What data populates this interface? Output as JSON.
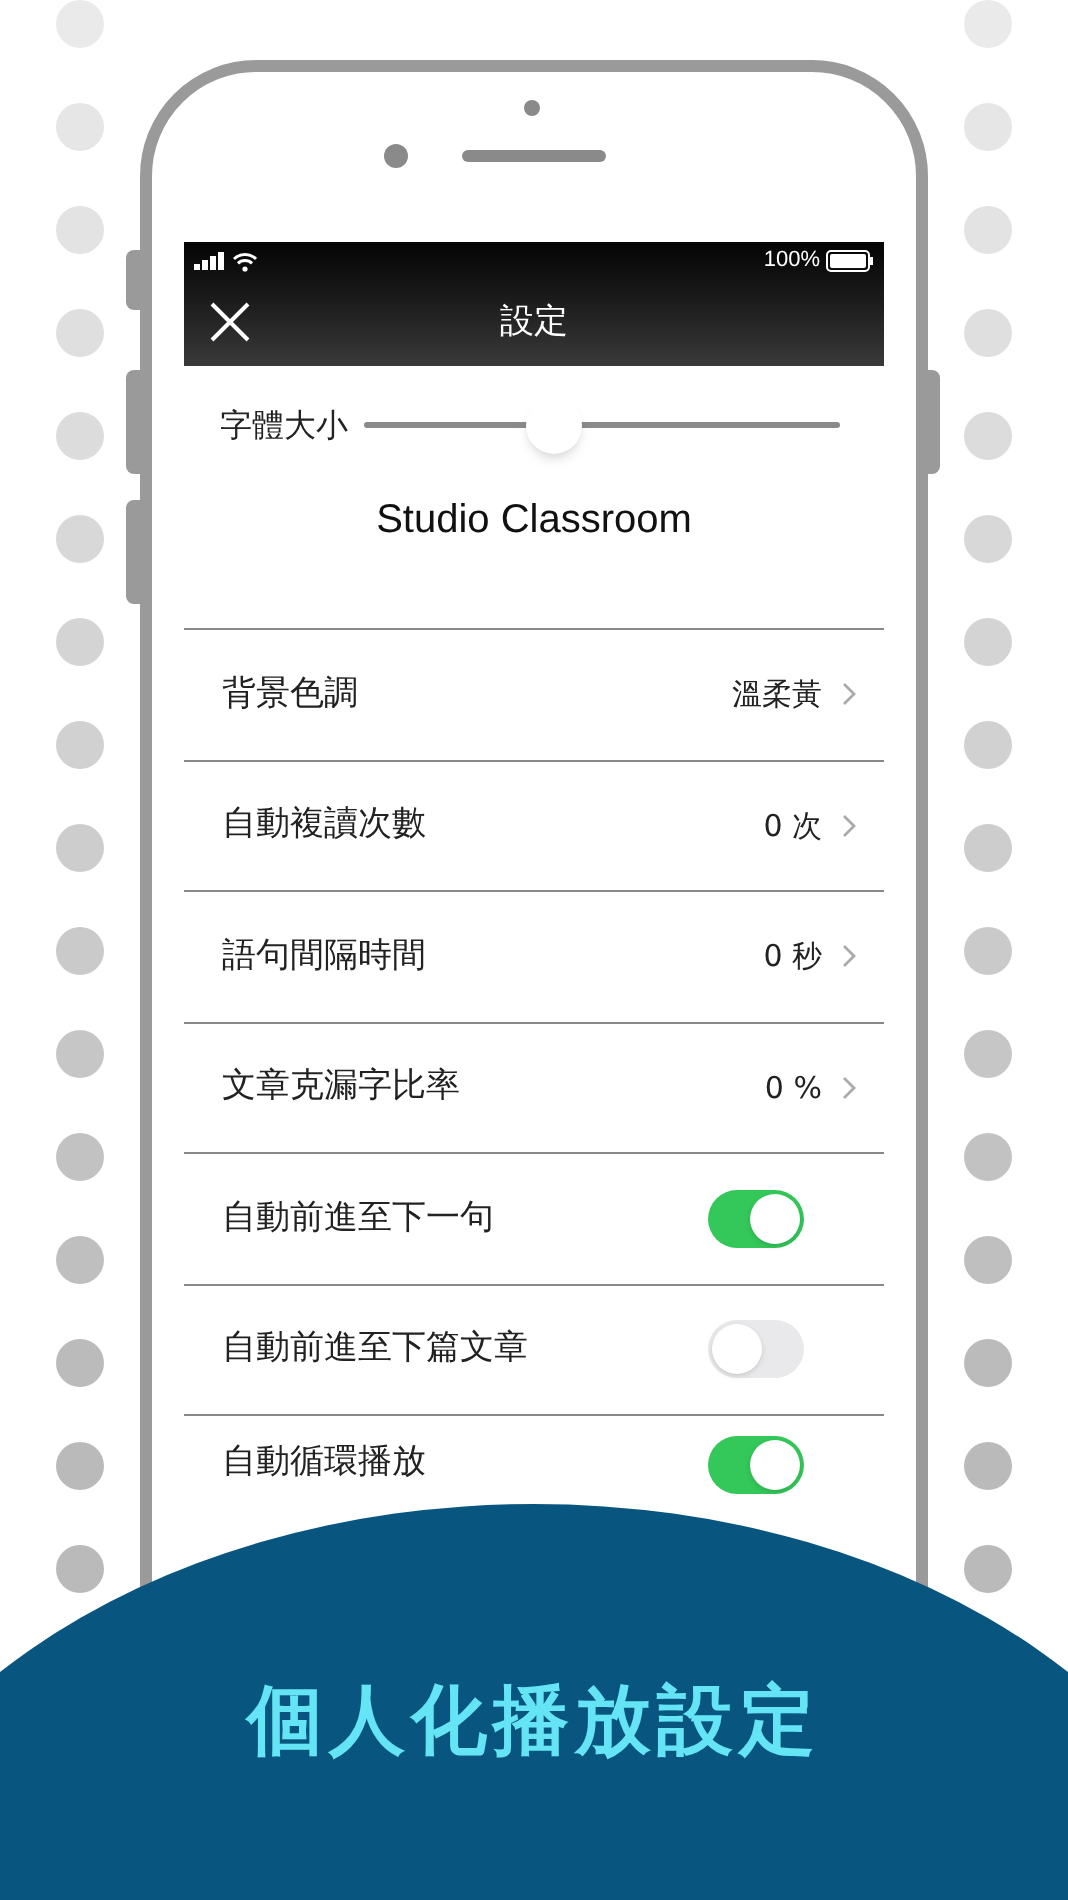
{
  "status_bar": {
    "battery": "100%"
  },
  "nav": {
    "title": "設定"
  },
  "font_size": {
    "label": "字體大小",
    "level": 0.4,
    "preview": "Studio Classroom"
  },
  "settings": [
    {
      "kind": "value",
      "label": "背景色調",
      "value": "溫柔黃"
    },
    {
      "kind": "value",
      "label": "自動複讀次數",
      "value": "0 次"
    },
    {
      "kind": "value",
      "label": "語句間隔時間",
      "value": "0 秒"
    },
    {
      "kind": "value",
      "label": "文章克漏字比率",
      "value": "0 %"
    },
    {
      "kind": "toggle",
      "label": "自動前進至下一句",
      "on": true
    },
    {
      "kind": "toggle",
      "label": "自動前進至下篇文章",
      "on": false
    },
    {
      "kind": "toggle",
      "label": "自動循環播放",
      "on": true
    }
  ],
  "banner": {
    "caption": "個人化播放設定"
  }
}
